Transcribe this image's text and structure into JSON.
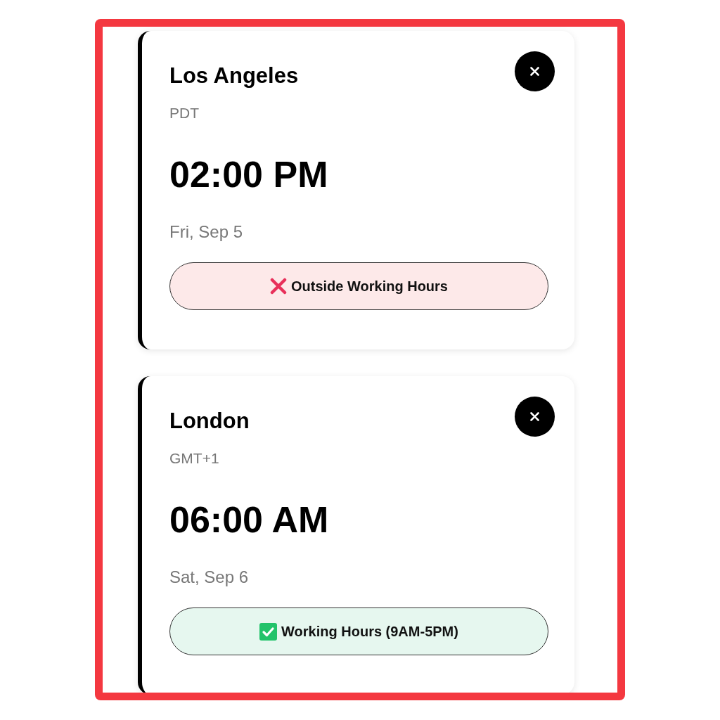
{
  "cities": [
    {
      "name": "Los Angeles",
      "timezone": "PDT",
      "time": "02:00 PM",
      "date": "Fri, Sep 5",
      "status": {
        "label": "Outside Working Hours",
        "within_hours": false
      }
    },
    {
      "name": "London",
      "timezone": "GMT+1",
      "time": "06:00 AM",
      "date": "Sat, Sep 6",
      "status": {
        "label": "Working Hours (9AM-5PM)",
        "within_hours": true
      }
    }
  ]
}
